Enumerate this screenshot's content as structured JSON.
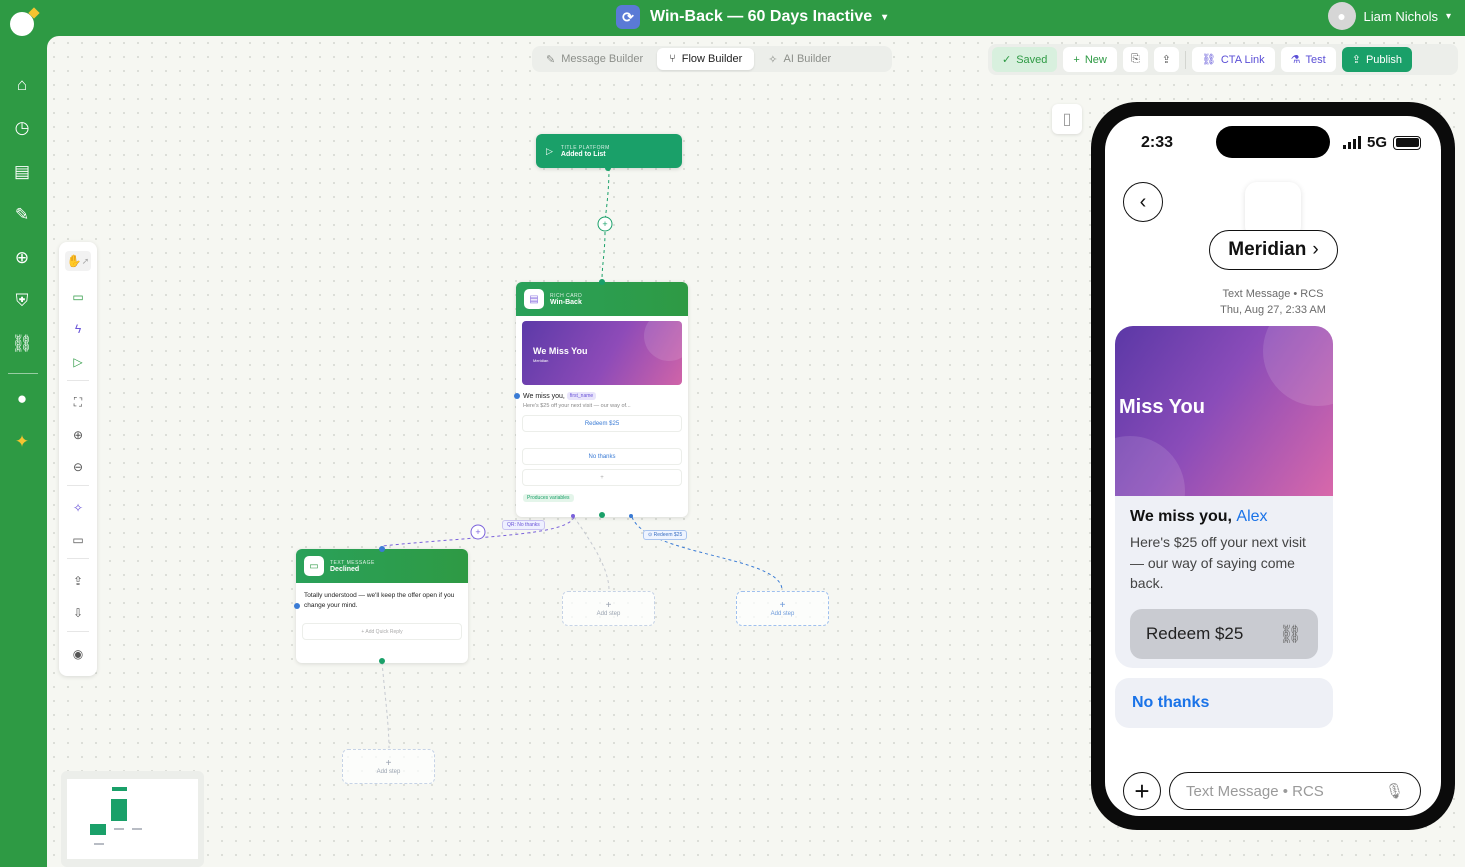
{
  "app": {
    "flow_title": "Win-Back — 60 Days Inactive",
    "user_name": "Liam Nichols"
  },
  "mode_tabs": [
    {
      "label": "Message Builder",
      "icon": "pencil-icon",
      "active": false
    },
    {
      "label": "Flow Builder",
      "icon": "flow-icon",
      "active": true
    },
    {
      "label": "AI Builder",
      "icon": "sparkle-icon",
      "active": false
    }
  ],
  "actions": {
    "saved": "Saved",
    "new": "New",
    "cta_link": "CTA Link",
    "test": "Test",
    "publish": "Publish"
  },
  "nav_icons": [
    "home-icon",
    "clock-icon",
    "document-icon",
    "edit-icon",
    "globe-icon",
    "shield-icon",
    "link-icon",
    "chat-icon",
    "sparkle-icon"
  ],
  "flow": {
    "trigger": {
      "type": "TITLE PLATFORM",
      "name": "Added to List"
    },
    "rich_card": {
      "type": "RICH CARD",
      "name": "Win-Back",
      "image_title": "We Miss You",
      "image_sub": "Meridian",
      "message": "We miss you,",
      "variable": "first_name",
      "desc": "Here's $25 off your next visit — our way of...",
      "buttons": [
        "Redeem $25",
        "No thanks"
      ],
      "add": "+",
      "produces": "Produces variables"
    },
    "edge_labels": {
      "qr": "QR: No thanks",
      "redeem": "Redeem $25"
    },
    "text_node": {
      "type": "TEXT MESSAGE",
      "name": "Declined",
      "body": "Totally understood — we'll keep the offer open if you change your mind.",
      "quick_reply": "+ Add Quick Reply"
    },
    "add_step": "Add step"
  },
  "phone": {
    "time": "2:33",
    "network": "5G",
    "brand": "Meridian",
    "meta_line1": "Text Message • RCS",
    "meta_line2": "Thu, Aug 27, 2:33 AM",
    "card_image_title": "Miss You",
    "card_title": "We miss you,",
    "card_name": "Alex",
    "card_desc": "Here's $25 off your next visit — our way of saying come back.",
    "card_button": "Redeem $25",
    "quick_reply": "No thanks",
    "compose_placeholder": "Text Message • RCS"
  }
}
